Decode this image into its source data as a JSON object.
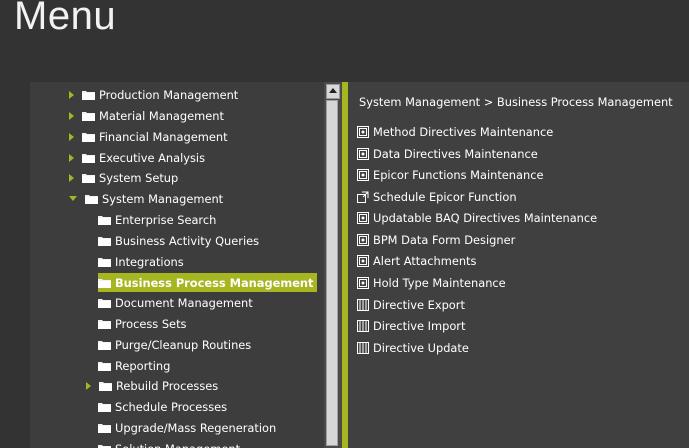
{
  "header": {
    "title": "Menu"
  },
  "tree": {
    "items": [
      {
        "label": "Production Management",
        "expander": "right",
        "level": 0
      },
      {
        "label": "Material Management",
        "expander": "right",
        "level": 0
      },
      {
        "label": "Financial Management",
        "expander": "right",
        "level": 0
      },
      {
        "label": "Executive Analysis",
        "expander": "right",
        "level": 0
      },
      {
        "label": "System Setup",
        "expander": "right",
        "level": 0
      },
      {
        "label": "System Management",
        "expander": "down",
        "level": 0
      },
      {
        "label": "Enterprise Search",
        "expander": "none",
        "level": 1
      },
      {
        "label": "Business Activity Queries",
        "expander": "none",
        "level": 1
      },
      {
        "label": "Integrations",
        "expander": "none",
        "level": 1
      },
      {
        "label": "Business Process Management",
        "expander": "none",
        "level": 1,
        "selected": true
      },
      {
        "label": "Document Management",
        "expander": "none",
        "level": 1
      },
      {
        "label": "Process Sets",
        "expander": "none",
        "level": 1
      },
      {
        "label": "Purge/Cleanup Routines",
        "expander": "none",
        "level": 1
      },
      {
        "label": "Reporting",
        "expander": "none",
        "level": 1
      },
      {
        "label": "Rebuild Processes",
        "expander": "right",
        "level": 1
      },
      {
        "label": "Schedule Processes",
        "expander": "none",
        "level": 1
      },
      {
        "label": "Upgrade/Mass Regeneration",
        "expander": "none",
        "level": 1
      },
      {
        "label": "Solution Management",
        "expander": "none",
        "level": 1
      }
    ]
  },
  "content": {
    "breadcrumb": "System Management > Business Process Management",
    "items": [
      {
        "label": "Method Directives Maintenance",
        "icon": "form-icon"
      },
      {
        "label": "Data Directives Maintenance",
        "icon": "form-icon"
      },
      {
        "label": "Epicor Functions Maintenance",
        "icon": "form-icon"
      },
      {
        "label": "Schedule Epicor Function",
        "icon": "process-icon"
      },
      {
        "label": "Updatable BAQ Directives Maintenance",
        "icon": "form-icon"
      },
      {
        "label": "BPM Data Form Designer",
        "icon": "form-icon"
      },
      {
        "label": "Alert Attachments",
        "icon": "form-icon"
      },
      {
        "label": "Hold Type Maintenance",
        "icon": "form-icon"
      },
      {
        "label": "Directive Export",
        "icon": "report-icon"
      },
      {
        "label": "Directive Import",
        "icon": "report-icon"
      },
      {
        "label": "Directive Update",
        "icon": "report-icon"
      }
    ]
  },
  "colors": {
    "accent": "#a7b521",
    "background": "#333333",
    "panel": "#3d3d3d"
  }
}
